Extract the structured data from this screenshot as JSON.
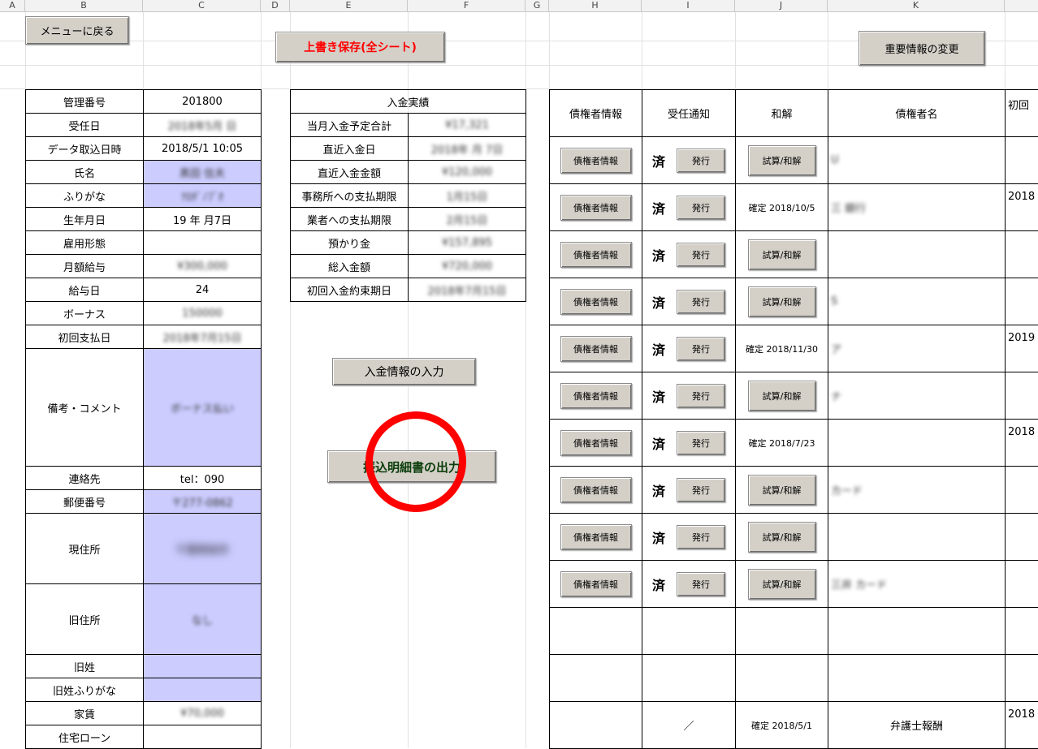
{
  "columns": [
    "A",
    "B",
    "C",
    "D",
    "E",
    "F",
    "G",
    "H",
    "I",
    "J",
    "K"
  ],
  "buttons": {
    "menu": "メニューに戻る",
    "save": "上書き保存(全シート)",
    "important": "重要情報の変更",
    "deposit_input": "入金情報の入力",
    "statement_output": "振込明細書の出力"
  },
  "left_rows": [
    {
      "label": "管理番号",
      "value": "201800"
    },
    {
      "label": "受任日",
      "value": "2018年5月 日"
    },
    {
      "label": "データ取込日時",
      "value": "2018/5/1 10:05"
    },
    {
      "label": "氏名",
      "value": "黒田 信夫"
    },
    {
      "label": "ふりがな",
      "value": "ｸﾛﾀﾞﾉﾌﾞｵ"
    },
    {
      "label": "生年月日",
      "value": "19 年 月7日"
    },
    {
      "label": "雇用形態",
      "value": ""
    },
    {
      "label": "月額給与",
      "value": "¥300,000"
    },
    {
      "label": "給与日",
      "value": "24"
    },
    {
      "label": "ボーナス",
      "value": "150000"
    },
    {
      "label": "初回支払日",
      "value": "2018年7月15日"
    },
    {
      "label": "備考・コメント",
      "value": "ボーナス払い"
    },
    {
      "label": "連絡先",
      "value": "tel：090"
    },
    {
      "label": "郵便番号",
      "value": "〒277-0862"
    },
    {
      "label": "現住所",
      "value": "千葉県柏市"
    },
    {
      "label": "旧住所",
      "value": "なし"
    },
    {
      "label": "旧姓",
      "value": ""
    },
    {
      "label": "旧姓ふりがな",
      "value": ""
    },
    {
      "label": "家賃",
      "value": "¥70,000"
    },
    {
      "label": "住宅ローン",
      "value": ""
    }
  ],
  "deposit": {
    "title": "入金実績",
    "rows": [
      {
        "label": "当月入金予定合計",
        "value": "¥17,321"
      },
      {
        "label": "直近入金日",
        "value": "2018年 月 7日"
      },
      {
        "label": "直近入金金額",
        "value": "¥120,000"
      },
      {
        "label": "事務所への支払期限",
        "value": "1月15日"
      },
      {
        "label": "業者への支払期限",
        "value": "2月15日"
      },
      {
        "label": "預かり金",
        "value": "¥157,895"
      },
      {
        "label": "総入金額",
        "value": "¥720,000"
      },
      {
        "label": "初回入金約束期日",
        "value": "2018年7月15日"
      }
    ]
  },
  "creditor": {
    "headers": [
      "債権者情報",
      "受任通知",
      "和解",
      "債権者名",
      "初回"
    ],
    "info_btn": "債権者情報",
    "issue_btn": "発行",
    "calc_btn": "試算/和解",
    "done": "済",
    "rows": [
      {
        "wakai": "",
        "name": "U",
        "extra": ""
      },
      {
        "wakai": "確定 2018/10/5",
        "name": "三 銀行",
        "extra": "2018"
      },
      {
        "wakai": "",
        "name": "",
        "extra": ""
      },
      {
        "wakai": "",
        "name": "S",
        "extra": ""
      },
      {
        "wakai": "確定 2018/11/30",
        "name": "ア",
        "extra": "2019"
      },
      {
        "wakai": "",
        "name": "ナ",
        "extra": ""
      },
      {
        "wakai": "確定 2018/7/23",
        "name": "",
        "extra": "2018"
      },
      {
        "wakai": "",
        "name": "カード",
        "extra": ""
      },
      {
        "wakai": "",
        "name": "",
        "extra": ""
      },
      {
        "wakai": "",
        "name": "三井 カード",
        "extra": ""
      }
    ],
    "fee_row": {
      "notice": "／",
      "wakai": "確定 2018/5/1",
      "name": "弁護士報酬",
      "extra": "2018"
    }
  }
}
